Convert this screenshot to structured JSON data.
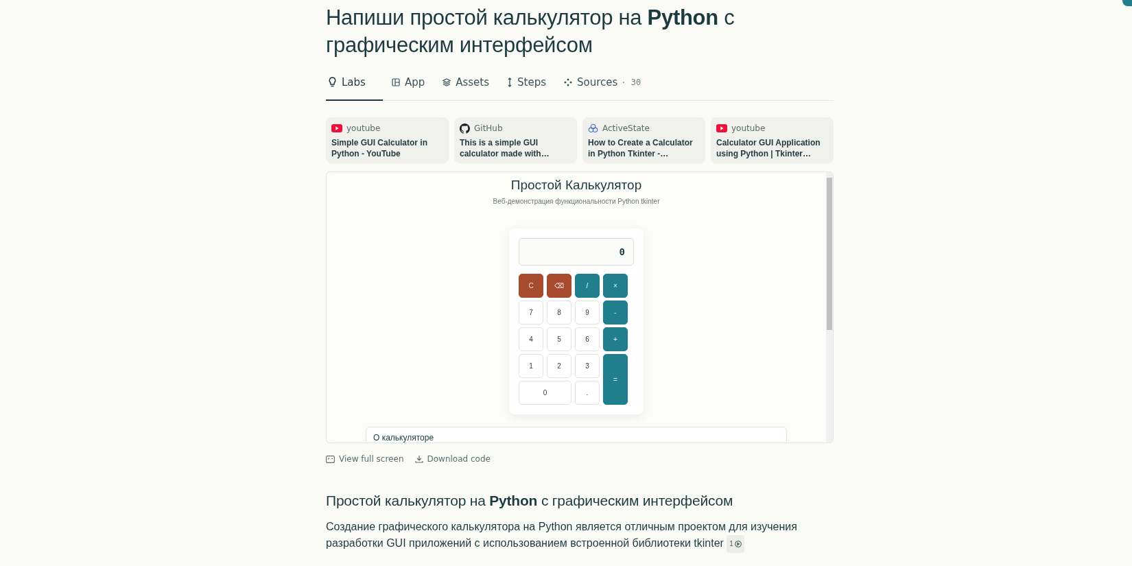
{
  "title": "Напиши простой калькулятор на **Python** с графическим интерфейсом",
  "tabs": [
    {
      "label": "Labs",
      "selected": true
    },
    {
      "label": "App",
      "selected": false
    },
    {
      "label": "Assets",
      "selected": false
    },
    {
      "label": "Steps",
      "selected": false
    },
    {
      "label": "Sources",
      "count": "· 30",
      "selected": false
    }
  ],
  "sources": [
    {
      "kind": "youtube",
      "site": "youtube",
      "title": "Simple GUI Calculator in Python - YouTube"
    },
    {
      "kind": "github",
      "site": "GitHub",
      "title": "This is a simple GUI calculator made with…"
    },
    {
      "kind": "activestate",
      "site": "ActiveState",
      "title": "How to Create a Calculator in Python Tkinter -…"
    },
    {
      "kind": "youtube",
      "site": "youtube",
      "title": "Calculator GUI Application using Python | Tkinter…"
    }
  ],
  "preview": {
    "title": "Простой Калькулятор",
    "subtitle": "Веб-демонстрация функциональности Python tkinter",
    "display": "0",
    "keys": [
      {
        "label": "C",
        "kind": "action",
        "wide": false,
        "tall": false
      },
      {
        "label": "⌫",
        "kind": "action",
        "wide": false,
        "tall": false
      },
      {
        "label": "/",
        "kind": "operator",
        "wide": false,
        "tall": false
      },
      {
        "label": "×",
        "kind": "operator",
        "wide": false,
        "tall": false
      },
      {
        "label": "7",
        "kind": "digit",
        "wide": false,
        "tall": false
      },
      {
        "label": "8",
        "kind": "digit",
        "wide": false,
        "tall": false
      },
      {
        "label": "9",
        "kind": "digit",
        "wide": false,
        "tall": false
      },
      {
        "label": "-",
        "kind": "operator",
        "wide": false,
        "tall": false
      },
      {
        "label": "4",
        "kind": "digit",
        "wide": false,
        "tall": false
      },
      {
        "label": "5",
        "kind": "digit",
        "wide": false,
        "tall": false
      },
      {
        "label": "6",
        "kind": "digit",
        "wide": false,
        "tall": false
      },
      {
        "label": "+",
        "kind": "operator",
        "wide": false,
        "tall": false
      },
      {
        "label": "1",
        "kind": "digit",
        "wide": false,
        "tall": false
      },
      {
        "label": "2",
        "kind": "digit",
        "wide": false,
        "tall": false
      },
      {
        "label": "3",
        "kind": "digit",
        "wide": false,
        "tall": false
      },
      {
        "label": "=",
        "kind": "operator",
        "wide": false,
        "tall": true
      },
      {
        "label": "0",
        "kind": "digit",
        "wide": true,
        "tall": false
      },
      {
        "label": ".",
        "kind": "digit",
        "wide": false,
        "tall": false
      }
    ],
    "about_title": "О калькуляторе"
  },
  "actions": [
    "View full screen",
    "Download code"
  ],
  "article": {
    "heading": "Простой калькулятор на **Python** с графическим интерфейсом",
    "paragraph": "Создание графического калькулятора на Python является отличным проектом для изучения разработки GUI приложений с использованием встроенной библиотеки tkinter",
    "citation": "1"
  }
}
